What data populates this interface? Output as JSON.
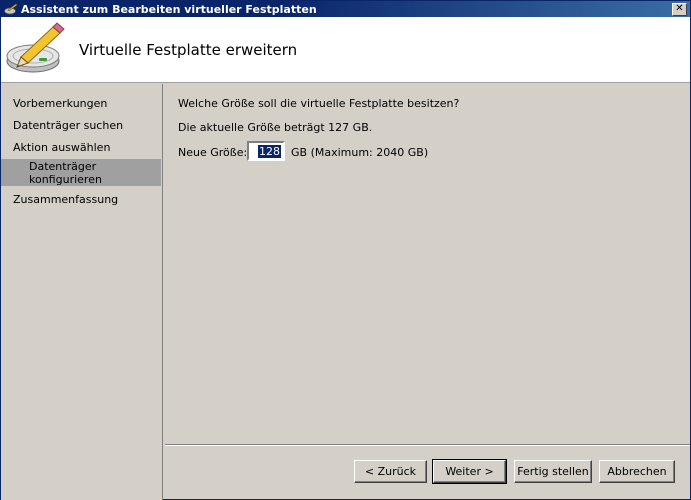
{
  "window": {
    "title": "Assistent zum Bearbeiten virtueller Festplatten",
    "close_label": "✕"
  },
  "header": {
    "title": "Virtuelle Festplatte erweitern",
    "icon": "disk-edit-icon"
  },
  "nav": {
    "items": [
      {
        "label": "Vorbemerkungen",
        "active": false
      },
      {
        "label": "Datenträger suchen",
        "active": false
      },
      {
        "label": "Aktion auswählen",
        "active": false
      },
      {
        "label_line1": "Datenträger",
        "label_line2": "konfigurieren",
        "active": true
      },
      {
        "label": "Zusammenfassung",
        "active": false
      }
    ]
  },
  "content": {
    "question": "Welche Größe soll die virtuelle Festplatte besitzen?",
    "current_size": "Die aktuelle Größe beträgt 127 GB.",
    "new_size_label": "Neue Größe:",
    "new_size_value": "128",
    "new_size_unit": "GB (Maximum: 2040 GB)"
  },
  "buttons": {
    "back": "< Zurück",
    "next": "Weiter >",
    "finish": "Fertig stellen",
    "cancel": "Abbrechen"
  },
  "colors": {
    "titlebar": "#0a246a",
    "window_bg": "#d4d0c8",
    "header_bg": "#ffffff",
    "nav_active": "#a0a0a0",
    "selection": "#0a246a"
  }
}
